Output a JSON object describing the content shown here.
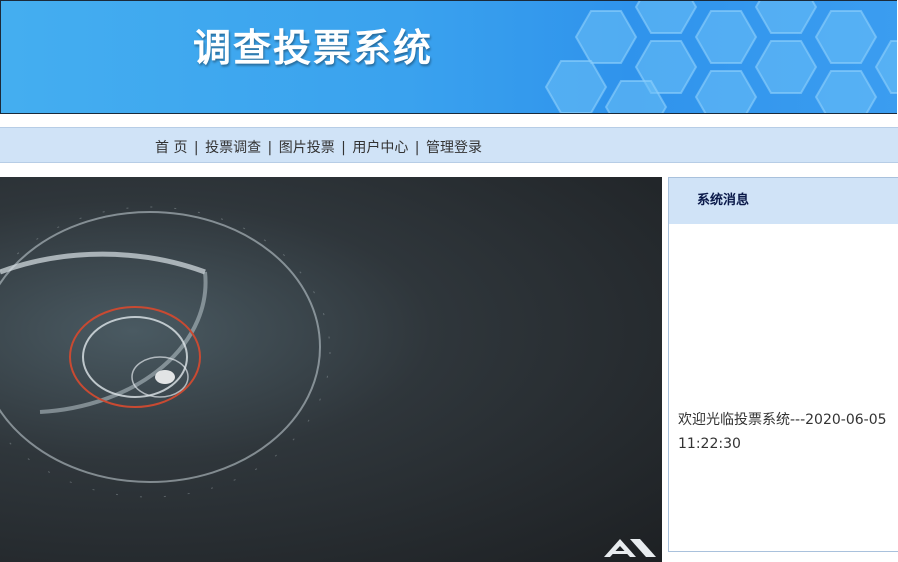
{
  "header": {
    "title": "调查投票系统"
  },
  "nav": {
    "items": [
      {
        "label": "首 页"
      },
      {
        "label": "投票调查"
      },
      {
        "label": "图片投票"
      },
      {
        "label": "用户中心"
      },
      {
        "label": "管理登录"
      }
    ],
    "separator": "|"
  },
  "messages": {
    "title": "系统消息",
    "line1": "欢迎光临投票系统---2020-06-05",
    "line2": "11:22:30"
  },
  "banner": {
    "logo_text": "AD"
  },
  "colors": {
    "header_blue": "#3aa2ee",
    "nav_bg": "#d0e3f7",
    "panel_border": "#a9c1dc"
  }
}
